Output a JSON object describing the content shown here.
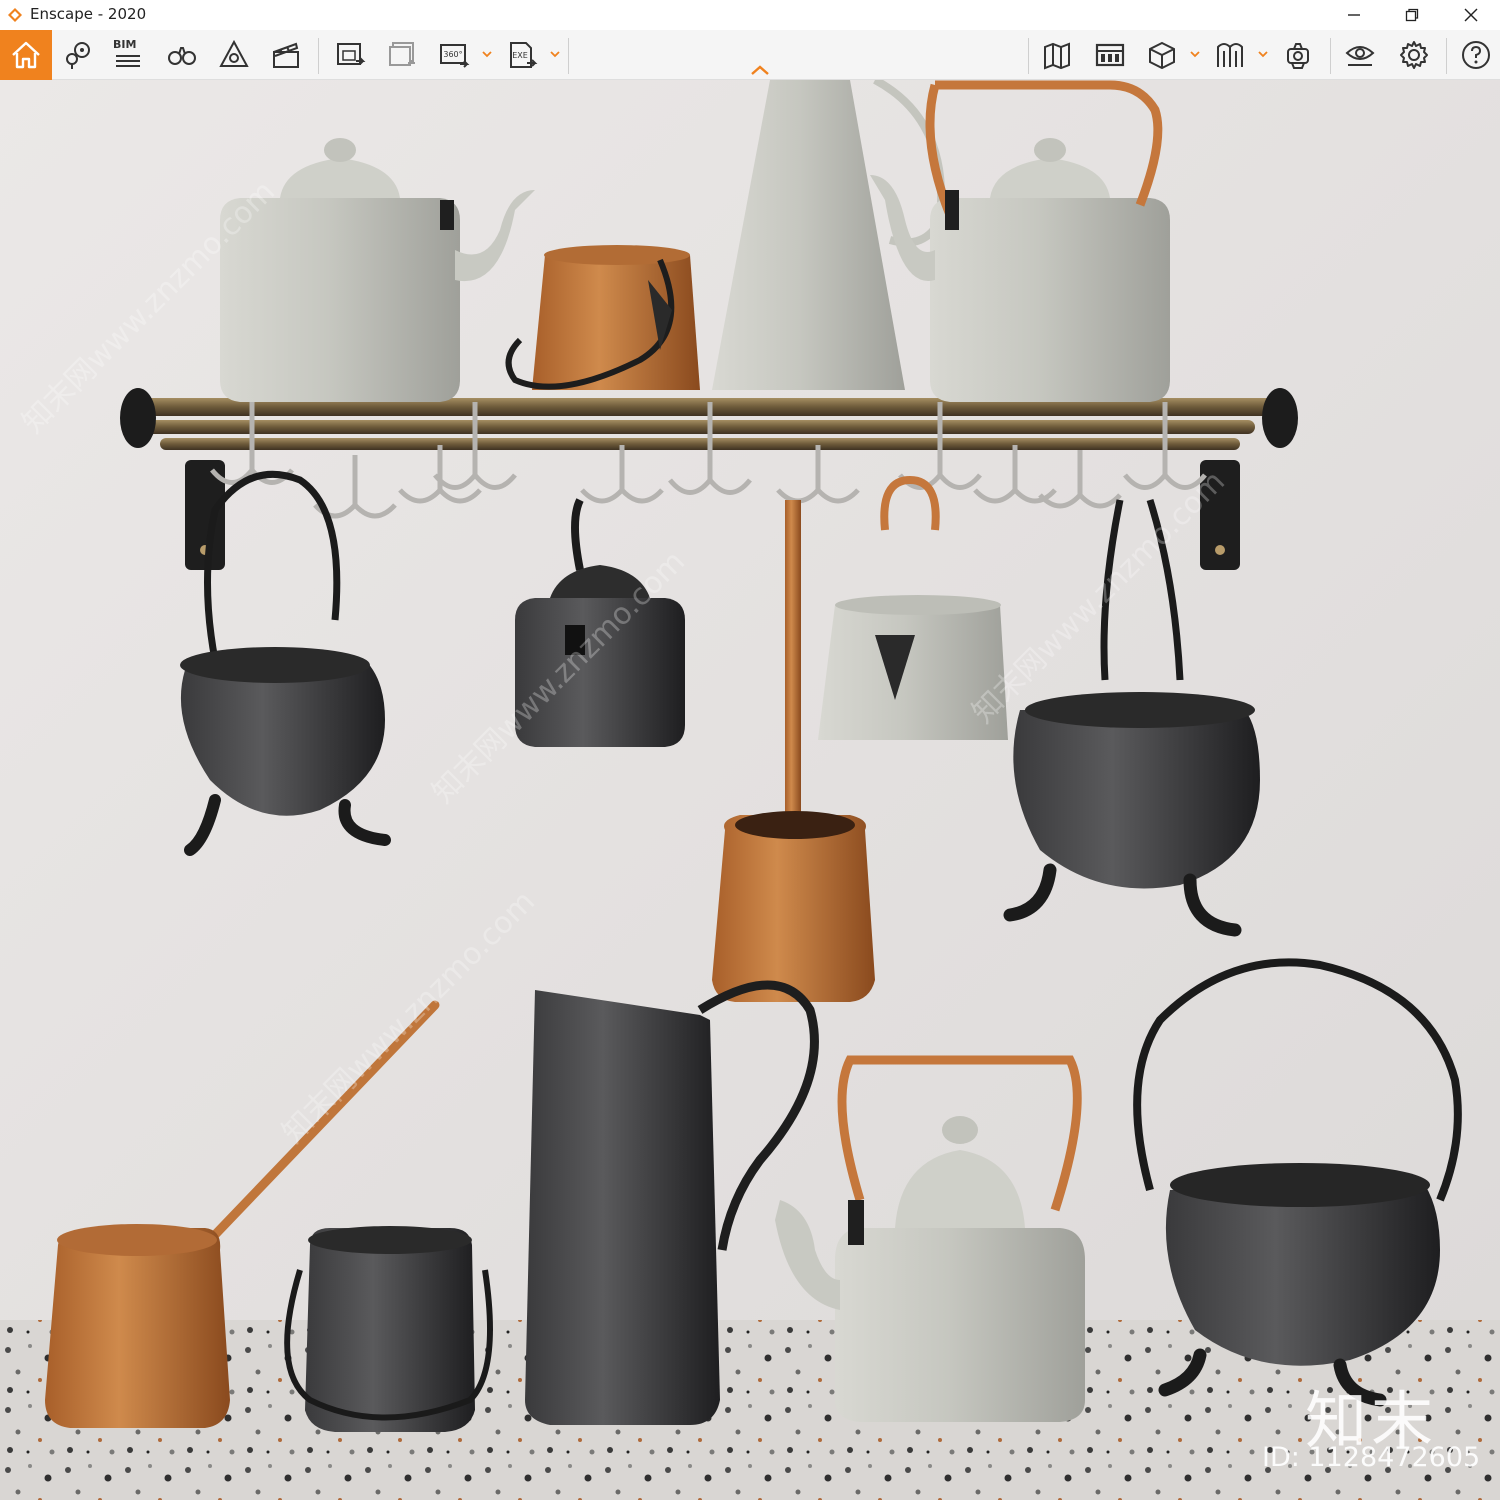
{
  "window": {
    "title": "Enscape - 2020",
    "controls": {
      "minimize": "minimize",
      "restore": "restore",
      "close": "close"
    }
  },
  "toolbar": {
    "accent_color": "#f0821e",
    "bim_label": "BIM",
    "left_tools": [
      {
        "name": "home-icon"
      },
      {
        "name": "location-pins-icon"
      },
      {
        "name": "bim-list-icon"
      },
      {
        "name": "binoculars-icon"
      },
      {
        "name": "asset-library-icon"
      },
      {
        "name": "video-editor-icon"
      },
      {
        "name": "screenshot-icon"
      },
      {
        "name": "batch-render-icon"
      },
      {
        "name": "panorama-360-icon"
      },
      {
        "name": "export-exe-icon"
      }
    ],
    "right_tools": [
      {
        "name": "map-icon"
      },
      {
        "name": "timeline-icon"
      },
      {
        "name": "cube-view-icon"
      },
      {
        "name": "assets-icon"
      },
      {
        "name": "views-icon"
      },
      {
        "name": "visual-settings-icon"
      },
      {
        "name": "settings-gear-icon"
      },
      {
        "name": "help-icon"
      }
    ],
    "panorama_badge": "360°",
    "exe_badge": "EXE"
  },
  "viewport": {
    "wall_color": "#e6e3e2",
    "watermark_brand": "知末",
    "watermark_id": "ID: 1128472605",
    "watermark_diagonal": "知末网www.znzmo.com"
  }
}
